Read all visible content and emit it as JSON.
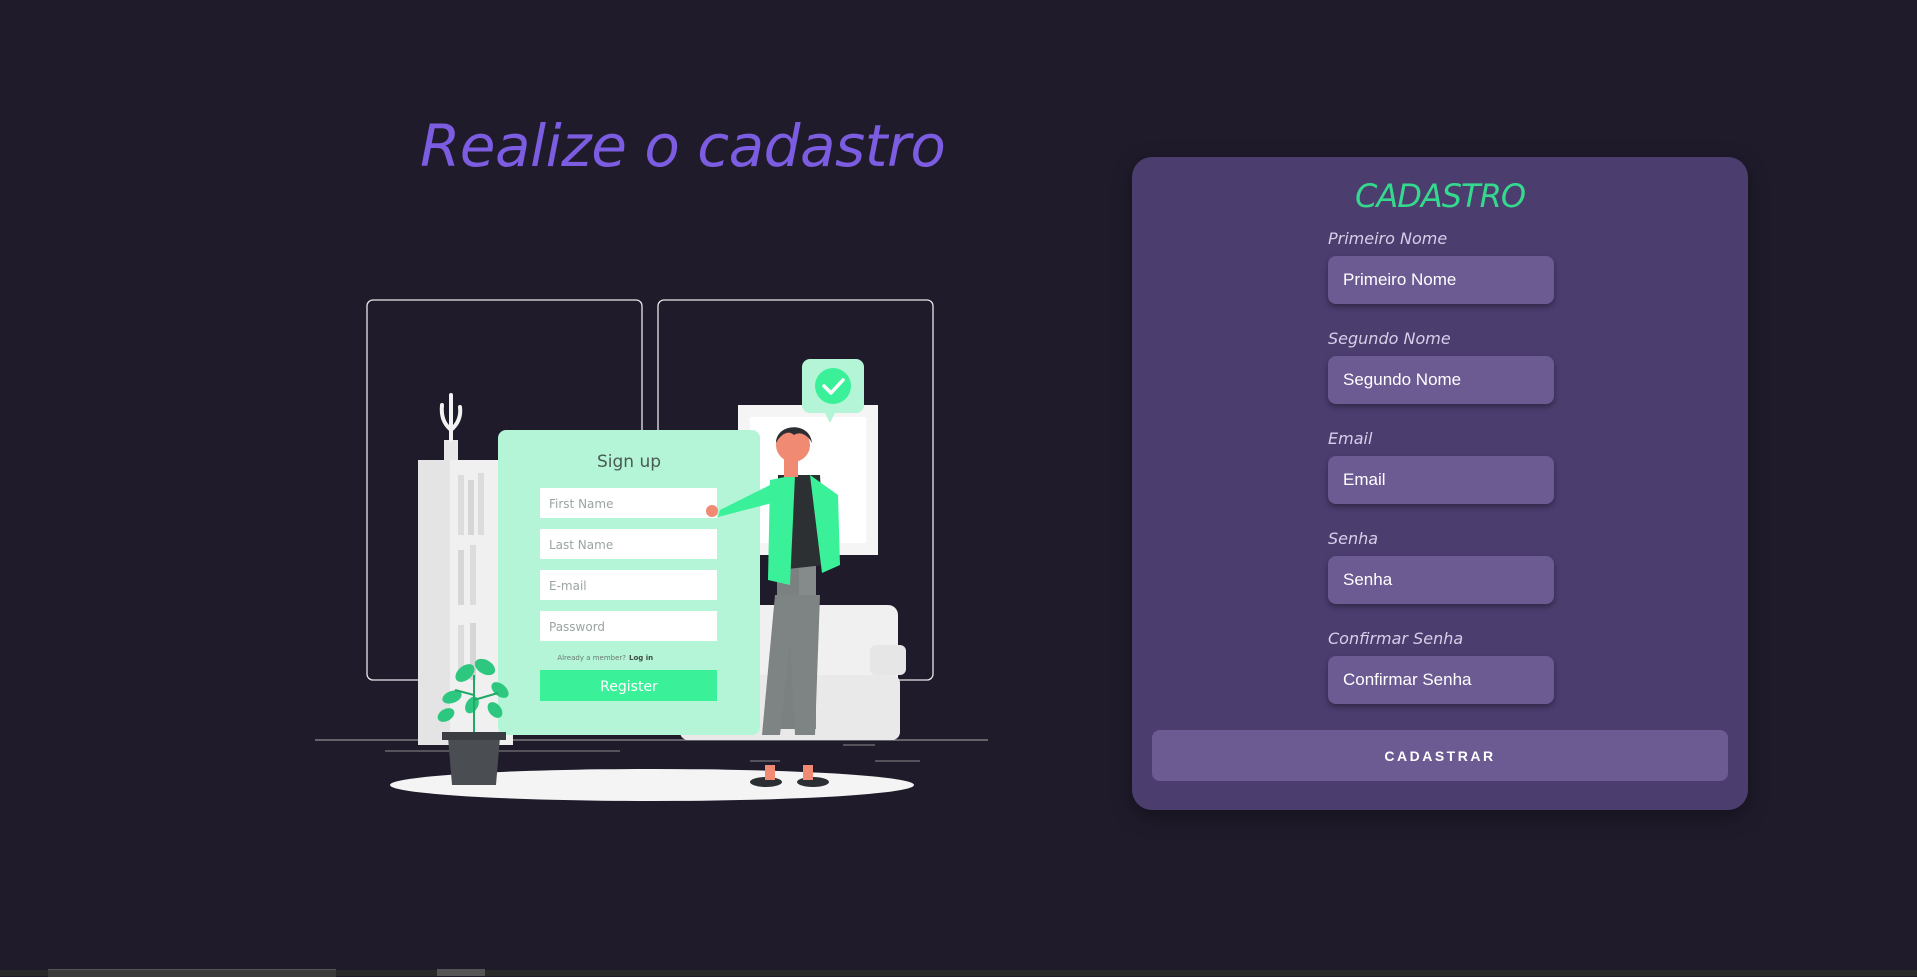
{
  "page": {
    "headline": "Realize o cadastro",
    "background_color": "#1f1b2b",
    "accent_color": "#7c5ce0"
  },
  "illustration": {
    "form_title": "Sign up",
    "fields": [
      "First Name",
      "Last Name",
      "E-mail",
      "Password"
    ],
    "member_prompt": "Already a member?",
    "login_link": "Log in",
    "register_label": "Register",
    "accent_color": "#3af19a"
  },
  "form": {
    "title": "CADASTRO",
    "title_color": "#34d98d",
    "card_color": "#4b3d6e",
    "input_color": "#6c5a93",
    "fields": [
      {
        "label": "Primeiro Nome",
        "placeholder": "Primeiro Nome"
      },
      {
        "label": "Segundo Nome",
        "placeholder": "Segundo Nome"
      },
      {
        "label": "Email",
        "placeholder": "Email"
      },
      {
        "label": "Senha",
        "placeholder": "Senha"
      },
      {
        "label": "Confirmar Senha",
        "placeholder": "Confirmar Senha"
      }
    ],
    "submit_label": "CADASTRAR"
  }
}
